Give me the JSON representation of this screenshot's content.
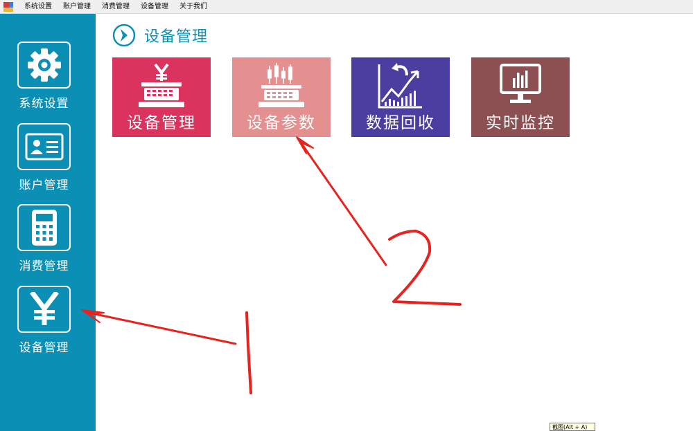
{
  "menu": [
    "系统设置",
    "账户管理",
    "消费管理",
    "设备管理",
    "关于我们"
  ],
  "sidebar": {
    "items": [
      {
        "label": "系统设置",
        "icon": "gear-icon"
      },
      {
        "label": "账户管理",
        "icon": "id-card-icon"
      },
      {
        "label": "消费管理",
        "icon": "calculator-icon"
      },
      {
        "label": "设备管理",
        "icon": "yen-icon"
      }
    ]
  },
  "header": {
    "title": "设备管理",
    "icon": "chevron-right-circle-icon"
  },
  "tiles": [
    {
      "label": "设备管理",
      "icon": "cash-register-yen-icon",
      "color": "#d9335e"
    },
    {
      "label": "设备参数",
      "icon": "cash-register-chart-icon",
      "color": "#e59090"
    },
    {
      "label": "数据回收",
      "icon": "data-chart-icon",
      "color": "#4a3fa0"
    },
    {
      "label": "实时监控",
      "icon": "monitor-icon",
      "color": "#8c4f52"
    }
  ],
  "annotations": {
    "number_1": "1",
    "number_2": "2",
    "color": "#e8231f"
  },
  "tooltip": "截图(Alt + A)",
  "colors": {
    "sidebar": "#0b8fb4",
    "accent": "#0b8fb4"
  }
}
